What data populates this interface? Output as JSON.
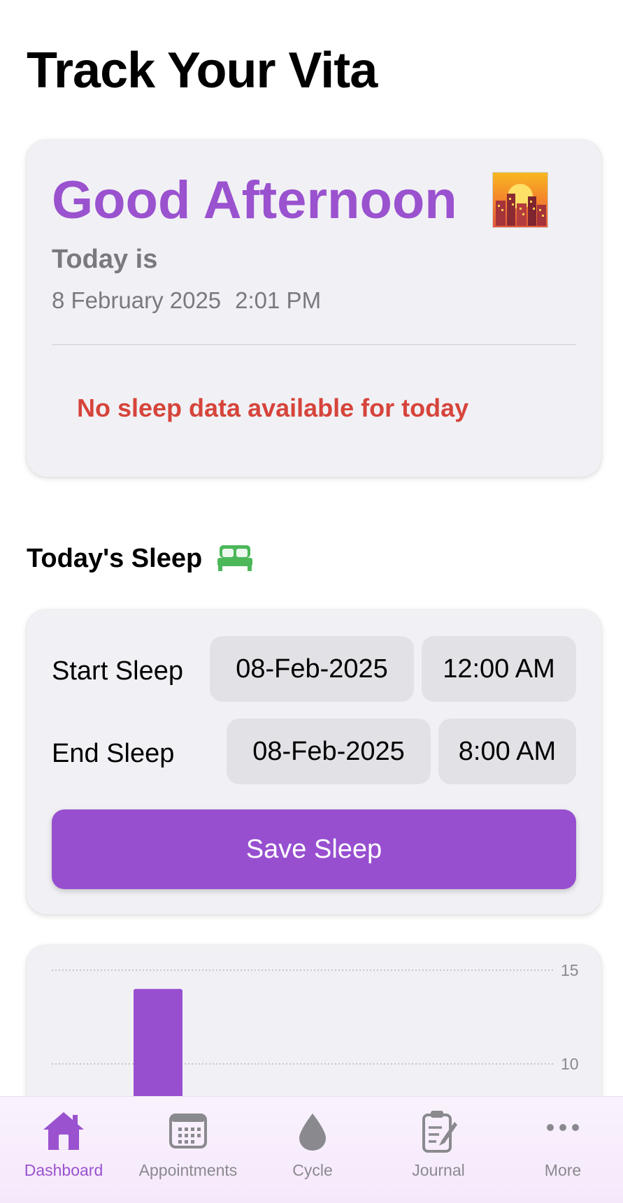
{
  "page": {
    "title": "Track Your Vita"
  },
  "greeting_card": {
    "greeting": "Good Afternoon",
    "greeting_icon": "sunset-city-icon",
    "today_label": "Today is",
    "date": "8 February 2025",
    "time": "2:01 PM",
    "no_data_message": "No sleep data available for today"
  },
  "sleep_section": {
    "title": "Today's Sleep",
    "icon": "bed-icon",
    "start": {
      "label": "Start Sleep",
      "date": "08-Feb-2025",
      "time": "12:00 AM"
    },
    "end": {
      "label": "End Sleep",
      "date": "08-Feb-2025",
      "time": "8:00 AM"
    },
    "save_label": "Save Sleep"
  },
  "chart_data": {
    "type": "bar",
    "categories": [
      ""
    ],
    "values": [
      14
    ],
    "yticks": [
      "15",
      "10"
    ],
    "ylim_visible": [
      8,
      15.5
    ],
    "grid": true,
    "bar_color": "#974fd0"
  },
  "tabbar": {
    "items": [
      {
        "label": "Dashboard",
        "icon": "house-icon",
        "active": true
      },
      {
        "label": "Appointments",
        "icon": "calendar-icon",
        "active": false
      },
      {
        "label": "Cycle",
        "icon": "drop-icon",
        "active": false
      },
      {
        "label": "Journal",
        "icon": "clipboard-pen-icon",
        "active": false
      },
      {
        "label": "More",
        "icon": "ellipsis-icon",
        "active": false
      }
    ]
  },
  "colors": {
    "accent": "#974fd0",
    "greeting": "#9a52cf",
    "error": "#d6443b",
    "card_bg": "#f1f1f5",
    "pill_bg": "#e1e1e6",
    "bed_icon": "#4cb85a"
  }
}
